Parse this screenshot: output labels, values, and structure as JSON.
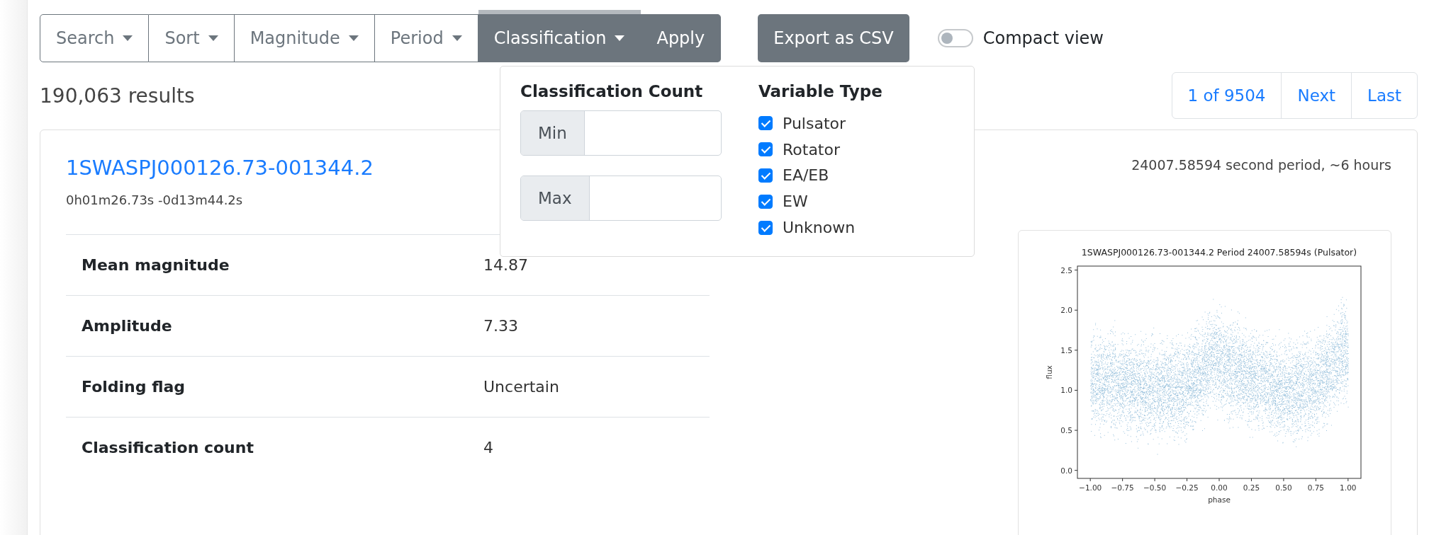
{
  "toolbar": {
    "filters": [
      {
        "label": "Search",
        "expanded": false
      },
      {
        "label": "Sort",
        "expanded": false
      },
      {
        "label": "Magnitude",
        "expanded": false
      },
      {
        "label": "Period",
        "expanded": false
      },
      {
        "label": "Classification",
        "expanded": true
      }
    ],
    "apply": "Apply",
    "export": "Export as CSV",
    "compact_view": {
      "label": "Compact view",
      "on": false
    }
  },
  "dropdown": {
    "count_heading": "Classification Count",
    "min_label": "Min",
    "max_label": "Max",
    "type_heading": "Variable Type",
    "types": [
      {
        "label": "Pulsator",
        "checked": true
      },
      {
        "label": "Rotator",
        "checked": true
      },
      {
        "label": "EA/EB",
        "checked": true
      },
      {
        "label": "EW",
        "checked": true
      },
      {
        "label": "Unknown",
        "checked": true
      }
    ]
  },
  "results": "190,063 results",
  "pagination": [
    {
      "label": "1 of 9504"
    },
    {
      "label": "Next"
    },
    {
      "label": "Last"
    }
  ],
  "result": {
    "name": "1SWASPJ000126.73-001344.2",
    "coords": "0h01m26.73s -0d13m44.2s",
    "period": "24007.58594 second period, ~6 hours",
    "rows": [
      {
        "label": "Mean magnitude",
        "value": "14.87"
      },
      {
        "label": "Amplitude",
        "value": "7.33"
      },
      {
        "label": "Folding flag",
        "value": "Uncertain"
      },
      {
        "label": "Classification count",
        "value": "4"
      }
    ],
    "plot": {
      "title": "1SWASPJ000126.73-001344.2 Period 24007.58594s (Pulsator)",
      "xlabel": "phase",
      "ylabel": "flux",
      "xticks": [
        "−1.00",
        "−0.75",
        "−0.50",
        "−0.25",
        "0.00",
        "0.25",
        "0.50",
        "0.75",
        "1.00"
      ],
      "yticks": [
        "2.5",
        "2.0",
        "1.5",
        "1.0",
        "0.5",
        "0.0"
      ]
    }
  }
}
